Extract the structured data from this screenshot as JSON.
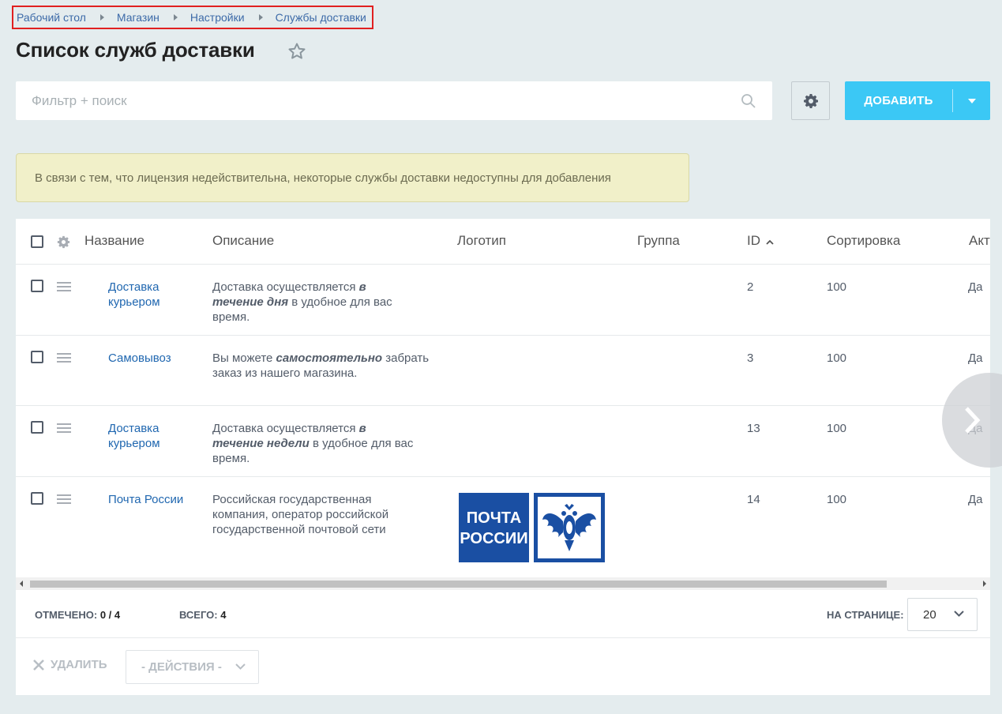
{
  "breadcrumb": [
    "Рабочий стол",
    "Магазин",
    "Настройки",
    "Службы доставки"
  ],
  "page_title": "Список служб доставки",
  "filter": {
    "placeholder": "Фильтр + поиск"
  },
  "toolbar": {
    "add_label": "ДОБАВИТЬ"
  },
  "alert": "В связи с тем, что лицензия недействительна, некоторые службы доставки недоступны для добавления",
  "table": {
    "columns": [
      "Название",
      "Описание",
      "Логотип",
      "Группа",
      "ID",
      "Сортировка",
      "Акт"
    ],
    "rows": [
      {
        "name": "Доставка курьером",
        "desc_pre": "Доставка осуществляется ",
        "desc_em": "в течение дня",
        "desc_post": " в удобное для вас время.",
        "id": "2",
        "sort": "100",
        "active": "Да"
      },
      {
        "name": "Самовывоз",
        "desc_pre": "Вы можете ",
        "desc_em": "самостоятельно",
        "desc_post": " забрать заказ из нашего магазина.",
        "id": "3",
        "sort": "100",
        "active": "Да"
      },
      {
        "name": "Доставка курьером",
        "desc_pre": "Доставка осуществляется ",
        "desc_em": "в течение недели",
        "desc_post": " в удобное для вас время.",
        "id": "13",
        "sort": "100",
        "active": "Да"
      },
      {
        "name": "Почта России",
        "desc_pre": "Российская государственная компания, оператор российской государственной почтовой сети",
        "desc_em": "",
        "desc_post": "",
        "id": "14",
        "sort": "100",
        "active": "Да",
        "logo_text": [
          "ПОЧТА",
          "РОССИИ"
        ]
      }
    ]
  },
  "footer": {
    "selected_label": "ОТМЕЧЕНО:",
    "selected_value": "0 / 4",
    "total_label": "ВСЕГО:",
    "total_value": "4",
    "per_page_label": "НА СТРАНИЦЕ:",
    "per_page_value": "20",
    "delete_label": "УДАЛИТЬ",
    "actions_label": "- ДЕЙСТВИЯ -"
  },
  "colors": {
    "accent": "#3bc8f5",
    "link": "#2067b0",
    "alert_bg": "#f1f0c9",
    "logo_blue": "#1a4fa3"
  }
}
